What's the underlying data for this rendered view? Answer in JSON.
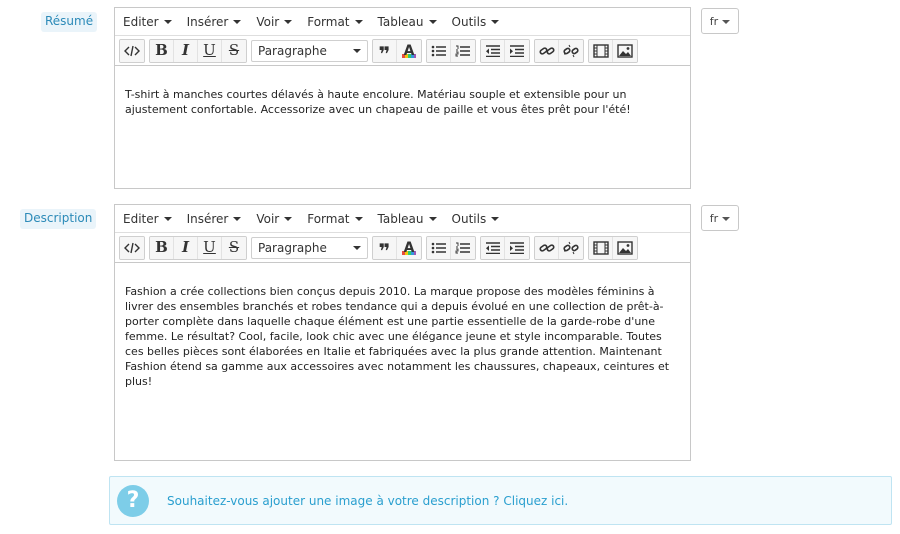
{
  "fields": [
    {
      "label": "Résumé",
      "lang": "fr",
      "content": "T-shirt à manches courtes délavés à haute encolure. Matériau souple et extensible pour un ajustement confortable. Accessorize avec un chapeau de paille et vous êtes prêt pour l'été!"
    },
    {
      "label": "Description",
      "lang": "fr",
      "content": "Fashion a crée collections bien conçus depuis 2010. La marque propose des modèles féminins à livrer des ensembles branchés et robes tendance qui a depuis évolué en une collection de prêt-à-porter complète dans laquelle chaque élément est une partie essentielle de la garde-robe d'une femme. Le résultat? Cool, facile, look chic avec une élégance jeune et style incomparable. Toutes ces belles pièces sont élaborées en Italie et fabriquées avec la plus grande attention. Maintenant Fashion étend sa gamme aux accessoires avec notamment les chaussures, chapeaux, ceintures et plus!"
    }
  ],
  "menubar": [
    "Editer",
    "Insérer",
    "Voir",
    "Format",
    "Tableau",
    "Outils"
  ],
  "toolbar": {
    "format_select": "Paragraphe",
    "buttons": [
      "code-icon",
      "bold-icon",
      "italic-icon",
      "underline-icon",
      "strikethrough-icon",
      "blockquote-icon",
      "text-color-icon",
      "bullet-list-icon",
      "numbered-list-icon",
      "outdent-icon",
      "indent-icon",
      "link-icon",
      "unlink-icon",
      "media-icon",
      "image-icon"
    ],
    "glyphs": {
      "bold": "B",
      "italic": "I",
      "underline": "U",
      "strikethrough": "S",
      "quote": "❞",
      "textcolor": "A"
    }
  },
  "info": {
    "icon_glyph": "?",
    "text": "Souhaitez-vous ajouter une image à votre description ?",
    "link": "Cliquez ici."
  },
  "colors": {
    "accent": "#2a9fcf",
    "label_bg": "#eaf4fa",
    "info_bg": "#f2fafd"
  }
}
